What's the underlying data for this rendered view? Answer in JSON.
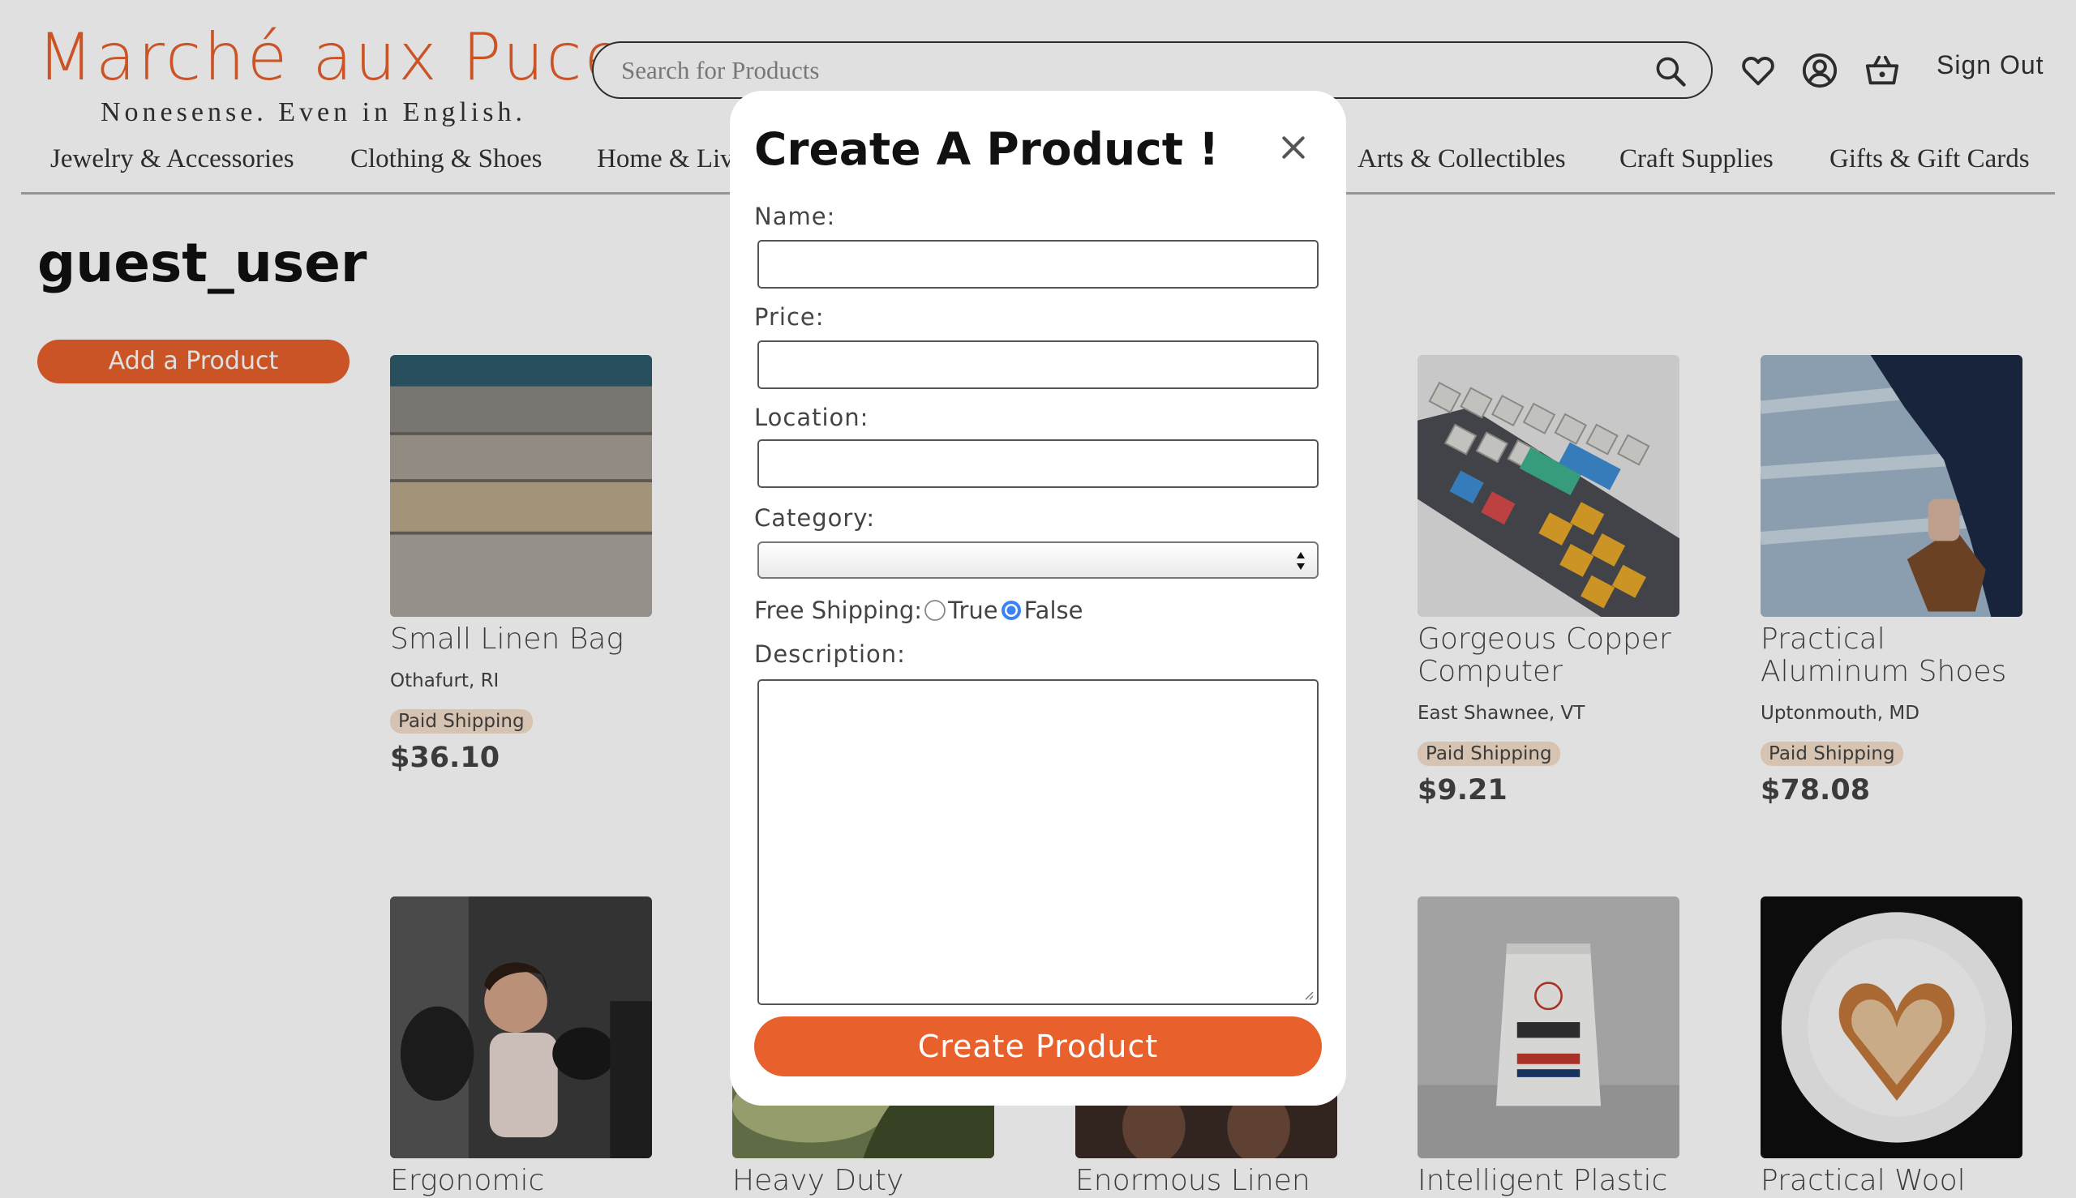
{
  "header": {
    "logo": "Marché aux Puces",
    "tagline": "Nonesense. Even in English.",
    "search_placeholder": "Search for Products",
    "sign_out": "Sign Out"
  },
  "nav": {
    "items": [
      "Jewelry & Accessories",
      "Clothing & Shoes",
      "Home & Living",
      "Arts & Collectibles",
      "Craft Supplies",
      "Gifts & Gift Cards"
    ]
  },
  "profile": {
    "username": "guest_user",
    "add_button": "Add a Product"
  },
  "products": [
    {
      "name": "Small Linen Bag",
      "location": "Othafurt, RI",
      "shipping": "Paid Shipping",
      "price": "$36.10"
    },
    {
      "name": "Gorgeous Copper Computer",
      "location": "East Shawnee, VT",
      "shipping": "Paid Shipping",
      "price": "$9.21"
    },
    {
      "name": "Practical Aluminum Shoes",
      "location": "Uptonmouth, MD",
      "shipping": "Paid Shipping",
      "price": "$78.08"
    },
    {
      "name": "Ergonomic Bronze"
    },
    {
      "name": "Heavy Duty"
    },
    {
      "name": "Enormous Linen"
    },
    {
      "name": "Intelligent Plastic"
    },
    {
      "name": "Practical Wool"
    }
  ],
  "modal": {
    "title": "Create A Product !",
    "name_label": "Name:",
    "price_label": "Price:",
    "location_label": "Location:",
    "category_label": "Category:",
    "shipping_label": "Free Shipping:",
    "true_label": "True",
    "false_label": "False",
    "description_label": "Description:",
    "submit": "Create Product",
    "name_value": "",
    "price_value": "",
    "location_value": "",
    "category_value": "",
    "description_value": "",
    "free_shipping_selected": "False"
  },
  "colors": {
    "accent": "#e8602c",
    "badge": "#f4dfcb",
    "radio_selected": "#3b82f6"
  }
}
